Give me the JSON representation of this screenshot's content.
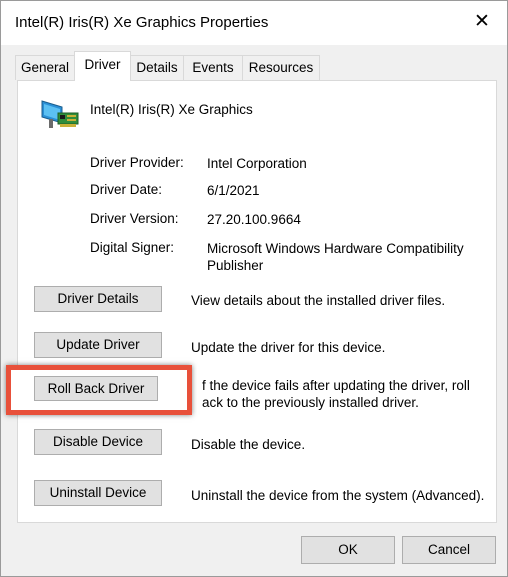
{
  "window": {
    "title": "Intel(R) Iris(R) Xe Graphics Properties",
    "close_glyph": "✕"
  },
  "tabs": [
    {
      "label": "General"
    },
    {
      "label": "Driver"
    },
    {
      "label": "Details"
    },
    {
      "label": "Events"
    },
    {
      "label": "Resources"
    }
  ],
  "device": {
    "name": "Intel(R) Iris(R) Xe Graphics",
    "icon": "display-adapter-icon"
  },
  "info": [
    {
      "label": "Driver Provider:",
      "value": "Intel Corporation"
    },
    {
      "label": "Driver Date:",
      "value": "6/1/2021"
    },
    {
      "label": "Driver Version:",
      "value": "27.20.100.9664"
    },
    {
      "label": "Digital Signer:",
      "value": "Microsoft Windows Hardware Compatibility Publisher"
    }
  ],
  "actions": [
    {
      "button": "Driver Details",
      "description": "View details about the installed driver files."
    },
    {
      "button": "Update Driver",
      "description": "Update the driver for this device."
    },
    {
      "button": "Roll Back Driver",
      "description_line1": "f the device fails after updating the driver, roll",
      "description_line2": "ack to the previously installed driver."
    },
    {
      "button": "Disable Device",
      "description": "Disable the device."
    },
    {
      "button": "Uninstall Device",
      "description": "Uninstall the device from the system (Advanced)."
    }
  ],
  "dialog_buttons": {
    "ok": "OK",
    "cancel": "Cancel"
  },
  "colors": {
    "highlight": "#e8503a",
    "button_face": "#e1e1e1",
    "dialog_bg": "#f0f0f0"
  }
}
